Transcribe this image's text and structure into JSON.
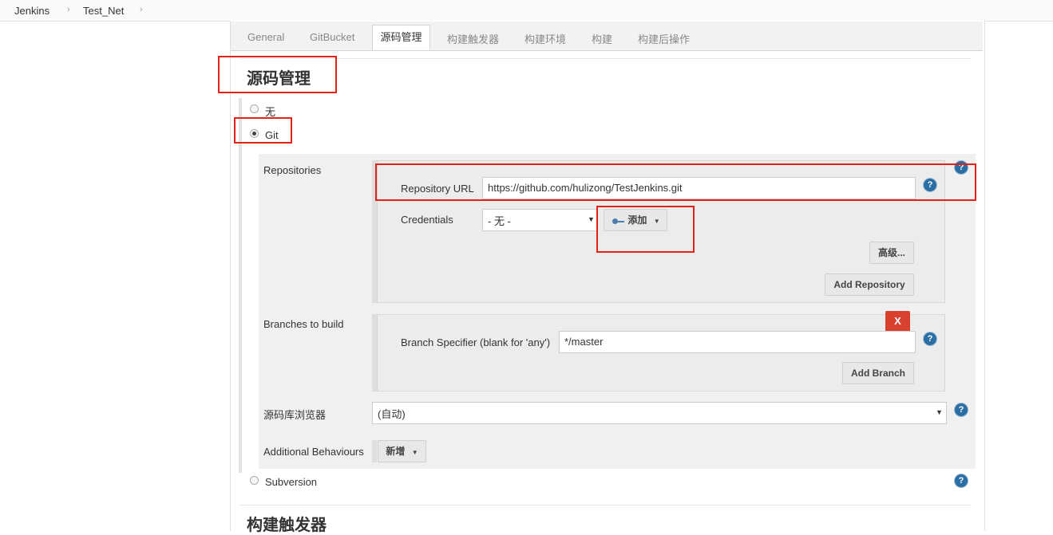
{
  "breadcrumb": {
    "items": [
      "Jenkins",
      "Test_Net"
    ]
  },
  "tabs": [
    "General",
    "GitBucket",
    "源码管理",
    "构建触发器",
    "构建环境",
    "构建",
    "构建后操作"
  ],
  "active_tab": "源码管理",
  "section": {
    "title": "源码管理",
    "option_none": "无",
    "option_git": "Git",
    "option_svn": "Subversion"
  },
  "git": {
    "repositories_label": "Repositories",
    "repo_url_label": "Repository URL",
    "repo_url_value": "https://github.com/hulizong/TestJenkins.git",
    "credentials_label": "Credentials",
    "credentials_value": "- 无 -",
    "add_credentials_label": "添加",
    "advanced_label": "高级...",
    "add_repository_label": "Add Repository",
    "branches_label": "Branches to build",
    "branch_spec_label": "Branch Specifier (blank for 'any')",
    "branch_spec_value": "*/master",
    "delete_label": "X",
    "add_branch_label": "Add Branch",
    "browser_label": "源码库浏览器",
    "browser_value": "(自动)",
    "behaviours_label": "Additional Behaviours",
    "add_behaviour_label": "新增"
  },
  "next_section_title": "构建触发器",
  "help_glyph": "?",
  "colors": {
    "highlight": "#e0221b",
    "help": "#2b6ea3",
    "delete": "#d9412f"
  }
}
